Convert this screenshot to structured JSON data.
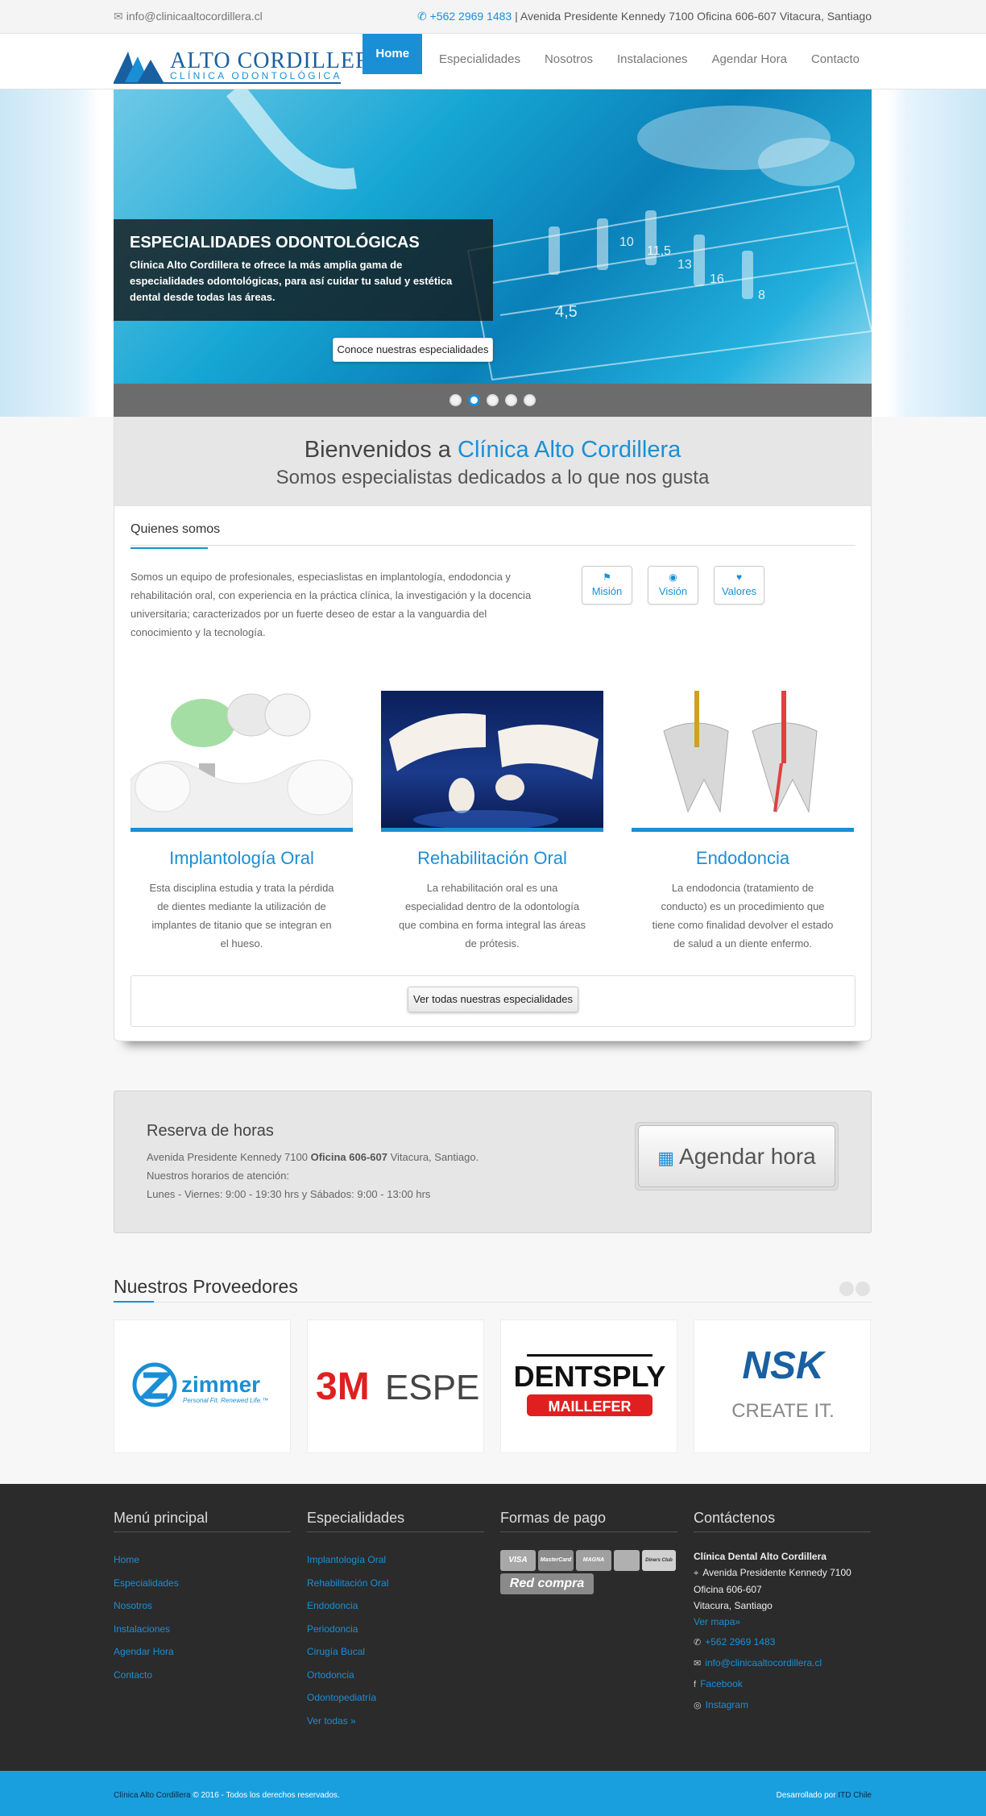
{
  "topbar": {
    "email": "info@clinicaaltocordillera.cl",
    "phone": "+562 2969 1483",
    "address": "| Avenida Presidente Kennedy 7100 Oficina 606-607 Vitacura, Santiago"
  },
  "brand": {
    "name": "ALTO CORDILLERA",
    "subtitle": "CLÍNICA ODONTOLÓGICA"
  },
  "nav": [
    {
      "label": "Home",
      "active": true
    },
    {
      "label": "Especialidades"
    },
    {
      "label": "Nosotros"
    },
    {
      "label": "Instalaciones"
    },
    {
      "label": "Agendar Hora"
    },
    {
      "label": "Contacto"
    }
  ],
  "slider": {
    "title": "ESPECIALIDADES ODONTOLÓGICAS",
    "text": "Clínica Alto Cordillera te ofrece la más amplia gama de especialidades odontológicas, para así cuidar tu salud y estética dental desde todas las áreas.",
    "button": "Conoce nuestras especialidades",
    "slide_count": 5,
    "active_slide": 2,
    "numbers": [
      "10",
      "11,5",
      "13",
      "16",
      "4,5",
      "8"
    ]
  },
  "welcome": {
    "line1_prefix": "Bienvenidos a ",
    "line1_highlight": "Clínica Alto Cordillera",
    "line2": "Somos especialistas dedicados a lo que nos gusta"
  },
  "about": {
    "title": "Quienes somos",
    "text": "Somos un equipo de profesionales, especiaslistas en implantología, endodoncia y rehabilitación oral, con experiencia en la práctica clínica, la investigación y la docencia universitaria; caracterizados por un fuerte deseo de estar a la vanguardia del conocimiento y la tecnología.",
    "buttons": [
      {
        "label": "Misión",
        "icon": "flag-icon"
      },
      {
        "label": "Visión",
        "icon": "eye-icon"
      },
      {
        "label": "Valores",
        "icon": "heart-icon"
      }
    ]
  },
  "specialties": [
    {
      "title": "Implantología Oral",
      "text": "Esta disciplina estudia y trata la pérdida de dientes mediante la utilización de implantes de titanio que se integran en el hueso."
    },
    {
      "title": "Rehabilitación Oral",
      "text": "La rehabilitación oral es una especialidad dentro de la odontología que combina en forma integral las áreas de prótesis."
    },
    {
      "title": "Endodoncia",
      "text": "La endodoncia (tratamiento de conducto) es un procedimiento que tiene como finalidad devolver el estado de salud a un diente enfermo."
    }
  ],
  "all_specialties_button": "Ver todas nuestras especialidades",
  "reserva": {
    "title": "Reserva de horas",
    "address_prefix": "Avenida Presidente Kennedy 7100 ",
    "address_bold": "Oficina 606-607",
    "address_suffix": " Vitacura, Santiago.",
    "hours_label": "Nuestros horarios de atención:",
    "hours": "Lunes - Viernes: 9:00 - 19:30 hrs y Sábados: 9:00 - 13:00 hrs",
    "button": "Agendar hora"
  },
  "providers": {
    "title": "Nuestros Proveedores",
    "logos": [
      {
        "name": "zimmer",
        "tagline": "Personal Fit. Renewed Life.™"
      },
      {
        "name": "3M",
        "suffix": "ESPE"
      },
      {
        "name": "DENTSPLY",
        "sub": "MAILLEFER"
      },
      {
        "name": "NSK",
        "sub": "CREATE IT."
      }
    ]
  },
  "footer": {
    "menu": {
      "title": "Menú principal",
      "items": [
        "Home",
        "Especialidades",
        "Nosotros",
        "Instalaciones",
        "Agendar Hora",
        "Contacto"
      ]
    },
    "specialties": {
      "title": "Especialidades",
      "items": [
        "Implantología Oral",
        "Rehabilitación Oral",
        "Endodoncia",
        "Periodoncia",
        "Cirugía Bucal",
        "Ortodoncia",
        "Odontopediatría",
        "Ver todas »"
      ]
    },
    "payments": {
      "title": "Formas de pago",
      "cards": [
        "VISA",
        "MasterCard",
        "MAGNA",
        "",
        "Diners Club",
        "Red compra"
      ]
    },
    "contact": {
      "title": "Contáctenos",
      "name": "Clínica Dental Alto Cordillera",
      "address1": "Avenida Presidente Kennedy 7100",
      "address2": "Oficina 606-607",
      "address3": "Vitacura, Santiago",
      "map_link": "Ver mapa»",
      "phone": "+562 2969 1483",
      "email": "info@clinicaaltocordillera.cl",
      "facebook": "Facebook",
      "instagram": "Instagram"
    }
  },
  "bottom": {
    "name": "Clínica Alto Cordillera",
    "copyright": " © 2016 - Todos los derechos reservados.",
    "dev_prefix": "Desarrollado por ",
    "dev_name": "ITD Chile"
  }
}
